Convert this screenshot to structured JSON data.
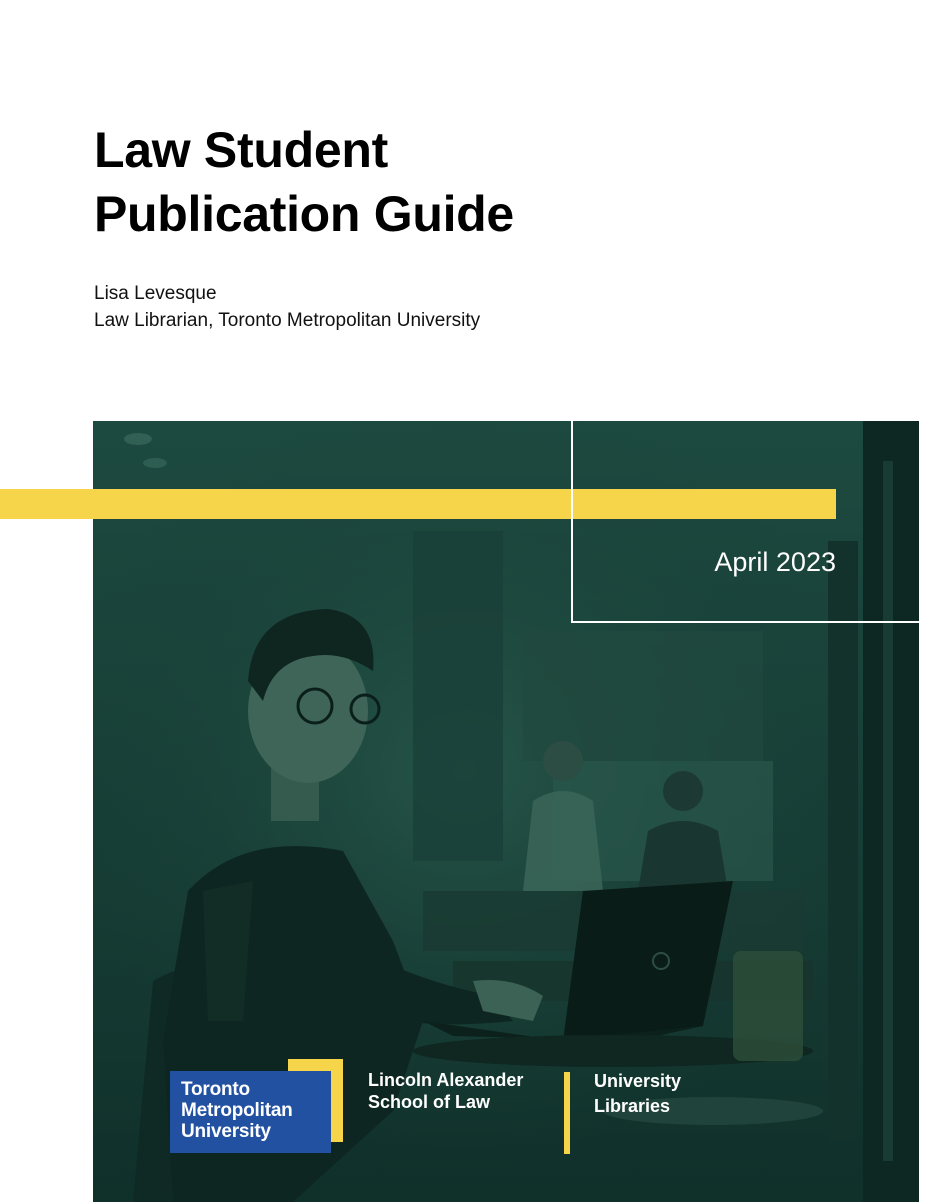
{
  "document": {
    "title_line1": "Law Student",
    "title_line2": "Publication Guide",
    "author_name": "Lisa Levesque",
    "author_role": "Law Librarian, Toronto Metropolitan University",
    "date": "April 2023"
  },
  "logos": {
    "tmu_line1": "Toronto",
    "tmu_line2": "Metropolitan",
    "tmu_line3": "University",
    "school_line1": "Lincoln Alexander",
    "school_line2": "School of Law",
    "libraries_line1": "University",
    "libraries_line2": "Libraries"
  },
  "colors": {
    "accent_yellow": "#f7d54a",
    "photo_tint": "#163f36",
    "tmu_blue": "#2251a2"
  }
}
